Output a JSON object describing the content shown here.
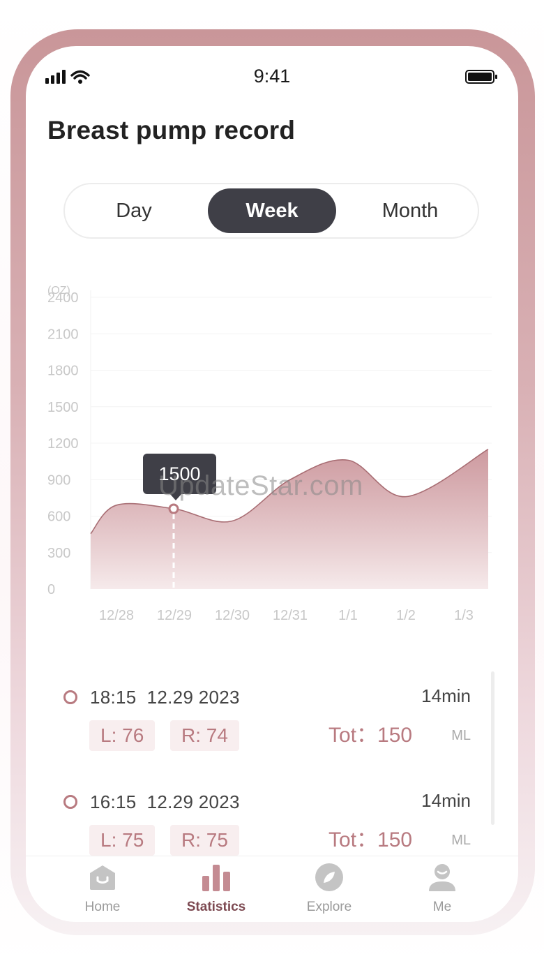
{
  "status_bar": {
    "time": "9:41"
  },
  "page": {
    "title": "Breast pump record"
  },
  "segment": {
    "day": "Day",
    "week": "Week",
    "month": "Month",
    "selected": "Week"
  },
  "chart_data": {
    "type": "area",
    "ylabel": "(OZ)",
    "ylim": [
      0,
      2400
    ],
    "y_ticks": [
      "0",
      "300",
      "600",
      "900",
      "1200",
      "1500",
      "1800",
      "2100",
      "2400"
    ],
    "categories": [
      "12/28",
      "12/29",
      "12/30",
      "12/31",
      "1/1",
      "1/2",
      "1/3"
    ],
    "values": [
      690,
      660,
      560,
      900,
      1060,
      760,
      1150
    ],
    "highlight": {
      "category": "12/29",
      "label": "1500"
    },
    "colors": {
      "fill_top": "#c88f95",
      "fill_bottom": "#f6eaeb",
      "line": "#a86d73"
    }
  },
  "records": [
    {
      "time": "18:15",
      "date": "12.29 2023",
      "duration": "14min",
      "left": "L: 76",
      "right": "R: 74",
      "total": "Tot：150",
      "unit": "ML"
    },
    {
      "time": "16:15",
      "date": "12.29 2023",
      "duration": "14min",
      "left": "L: 75",
      "right": "R: 75",
      "total": "Tot：150",
      "unit": "ML"
    }
  ],
  "tabs": [
    {
      "label": "Home",
      "icon": "home-icon"
    },
    {
      "label": "Statistics",
      "icon": "bar-chart-icon",
      "active": true
    },
    {
      "label": "Explore",
      "icon": "compass-icon"
    },
    {
      "label": "Me",
      "icon": "user-icon"
    }
  ],
  "watermark": "UpdateStar.com"
}
